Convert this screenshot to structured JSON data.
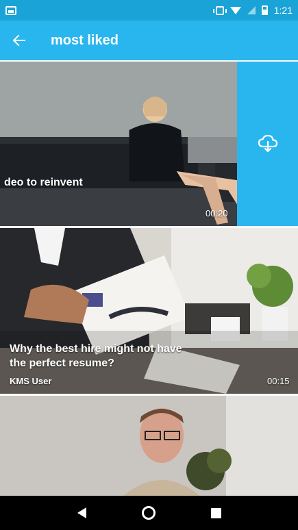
{
  "status_bar": {
    "time": "1:21",
    "icons": [
      "screenshot-icon",
      "vibrate-icon",
      "wifi-icon",
      "signal-icon",
      "battery-icon"
    ]
  },
  "app_bar": {
    "title": "most liked",
    "back_icon": "arrow-back-icon",
    "color": "#29b6ee"
  },
  "videos": [
    {
      "title": "deo to reinvent",
      "duration": "00:20",
      "user": "",
      "swipe_action_icon": "cloud-download-icon"
    },
    {
      "title_line1": "Why the best hire might not have",
      "title_line2": "the perfect resume?",
      "user": "KMS User",
      "duration": "00:15"
    },
    {
      "title": "",
      "duration": "",
      "user": ""
    }
  ],
  "nav_bar": {
    "buttons": [
      "nav-back-icon",
      "nav-home-icon",
      "nav-recents-icon"
    ]
  }
}
